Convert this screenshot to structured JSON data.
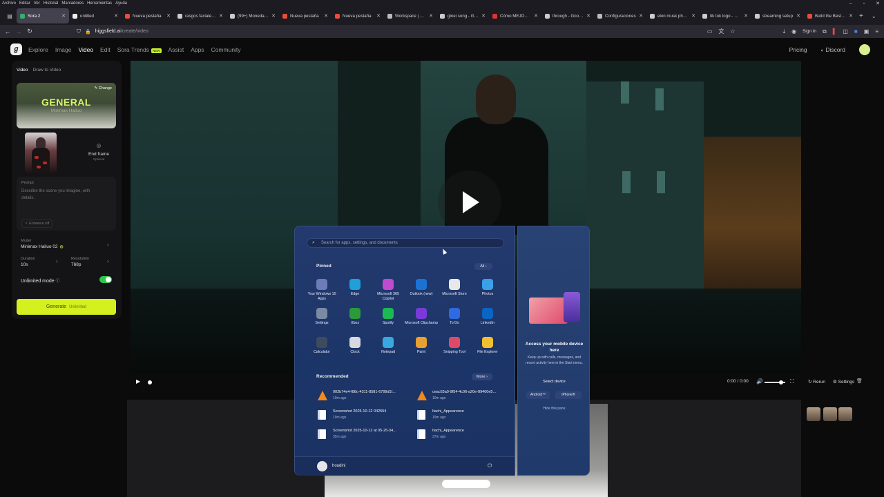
{
  "browser": {
    "menu": [
      "Archivo",
      "Editar",
      "Ver",
      "Historial",
      "Marcadores",
      "Herramientas",
      "Ayuda"
    ],
    "tabs": [
      {
        "label": "Sora 2",
        "color": "#2fb26b",
        "active": true
      },
      {
        "label": "untitled",
        "color": "#eeeeee"
      },
      {
        "label": "Nueva pestaña",
        "color": "#e74c3c"
      },
      {
        "label": "rasgos faciales en",
        "color": "#cccccc"
      },
      {
        "label": "(99+) Monedas de",
        "color": "#cccccc"
      },
      {
        "label": "Nueva pestaña",
        "color": "#e74c3c"
      },
      {
        "label": "Nueva pestaña",
        "color": "#e74c3c"
      },
      {
        "label": "Workspace | LIVE",
        "color": "#bbbbbb"
      },
      {
        "label": "ginei song - Goog",
        "color": "#cccccc"
      },
      {
        "label": "Cómo MEJORAR",
        "color": "#e0332c"
      },
      {
        "label": "through - Google",
        "color": "#cccccc"
      },
      {
        "label": "Configuraciones",
        "color": "#bbbbbb"
      },
      {
        "label": "elon musk photo",
        "color": "#cccccc"
      },
      {
        "label": "tik tok logo - Goo",
        "color": "#cccccc"
      },
      {
        "label": "streaming setup",
        "color": "#cccccc"
      },
      {
        "label": "Build the Best Mi",
        "color": "#e74c3c"
      }
    ],
    "url_domain": "higgsfield.ai",
    "url_path": "/create/video",
    "signin": "Sign in"
  },
  "app": {
    "logo": "ℊ",
    "nav": [
      "Explore",
      "Image",
      "Video",
      "Edit",
      "Sora Trends",
      "Assist",
      "Apps",
      "Community"
    ],
    "new_badge": "NEW",
    "pricing": "Pricing",
    "discord": "Discord"
  },
  "panel": {
    "tabs": [
      "Video",
      "Draw to Video"
    ],
    "model_card_title": "GENERAL",
    "model_card_sub": "Minimax Hailuo",
    "change": "Change",
    "end_frame": "End frame",
    "end_frame_opt": "Optional",
    "prompt_label": "Prompt",
    "prompt_placeholder": "Describe the scene you imagine, with details.",
    "enhance": "Enhance off",
    "model_label": "Model",
    "model_value": "Minimax Hailuo 02",
    "duration_label": "Duration",
    "duration_value": "10s",
    "resolution_label": "Resolution",
    "resolution_value": "768p",
    "unlimited_label": "Unlimited mode",
    "unlimited_on": true,
    "generate": "Generate",
    "generate_sub": "Unlimited"
  },
  "player": {
    "time": "0:00 / 0:00",
    "volume_fraction": 0.8,
    "rerun": "Rerun",
    "settings": "Settings"
  },
  "startmenu": {
    "search_placeholder": "Search for apps, settings, and documents",
    "pinned_title": "Pinned",
    "all": "All",
    "pinned": [
      {
        "label": "Your Windows 10 Apps",
        "color": "#6b7cb8"
      },
      {
        "label": "Edge",
        "color": "#1fa0d8"
      },
      {
        "label": "Microsoft 365 Copilot",
        "color": "#c04ad0"
      },
      {
        "label": "Outlook (new)",
        "color": "#1a73d4"
      },
      {
        "label": "Microsoft Store",
        "color": "#e8e8e8"
      },
      {
        "label": "Photos",
        "color": "#3aa0e8"
      },
      {
        "label": "Settings",
        "color": "#7a8aa4"
      },
      {
        "label": "Xbox",
        "color": "#2b9a3a"
      },
      {
        "label": "Spotify",
        "color": "#1db954"
      },
      {
        "label": "Microsoft Clipchamp",
        "color": "#7a3ad8"
      },
      {
        "label": "To Do",
        "color": "#2e6ae0"
      },
      {
        "label": "LinkedIn",
        "color": "#0a66c2"
      },
      {
        "label": "Calculator",
        "color": "#3e4a5e"
      },
      {
        "label": "Clock",
        "color": "#d8d8e0"
      },
      {
        "label": "Notepad",
        "color": "#3aa8e0"
      },
      {
        "label": "Paint",
        "color": "#e8a030"
      },
      {
        "label": "Snipping Tool",
        "color": "#e04a6a"
      },
      {
        "label": "File Explorer",
        "color": "#f0c030"
      }
    ],
    "recommended_title": "Recommended",
    "more": "More",
    "recommended": [
      {
        "name": "002b74e4-f88c-4311-8581-6799d1f...",
        "time": "10m ago",
        "kind": "vlc"
      },
      {
        "name": "ceac63a0-9f54-4c06-a20e-89400e5...",
        "time": "10m ago",
        "kind": "vlc"
      },
      {
        "name": "Screenshot 2025-10-12 042554",
        "time": "19m ago",
        "kind": "doc"
      },
      {
        "name": "Itachi_Appearence",
        "time": "19m ago",
        "kind": "doc"
      },
      {
        "name": "Screenshot 2025-10-12 at 05-25-34...",
        "time": "35m ago",
        "kind": "doc"
      },
      {
        "name": "Itachi_Appearence",
        "time": "37m ago",
        "kind": "doc"
      }
    ],
    "user": "houdini",
    "phone_title": "Access your mobile device here",
    "phone_desc": "Keep up with calls, messages, and recent activity here in the Start menu.",
    "select_device": "Select device",
    "android": "Android™",
    "iphone": "iPhone®",
    "hide_pane": "Hide this pane"
  }
}
